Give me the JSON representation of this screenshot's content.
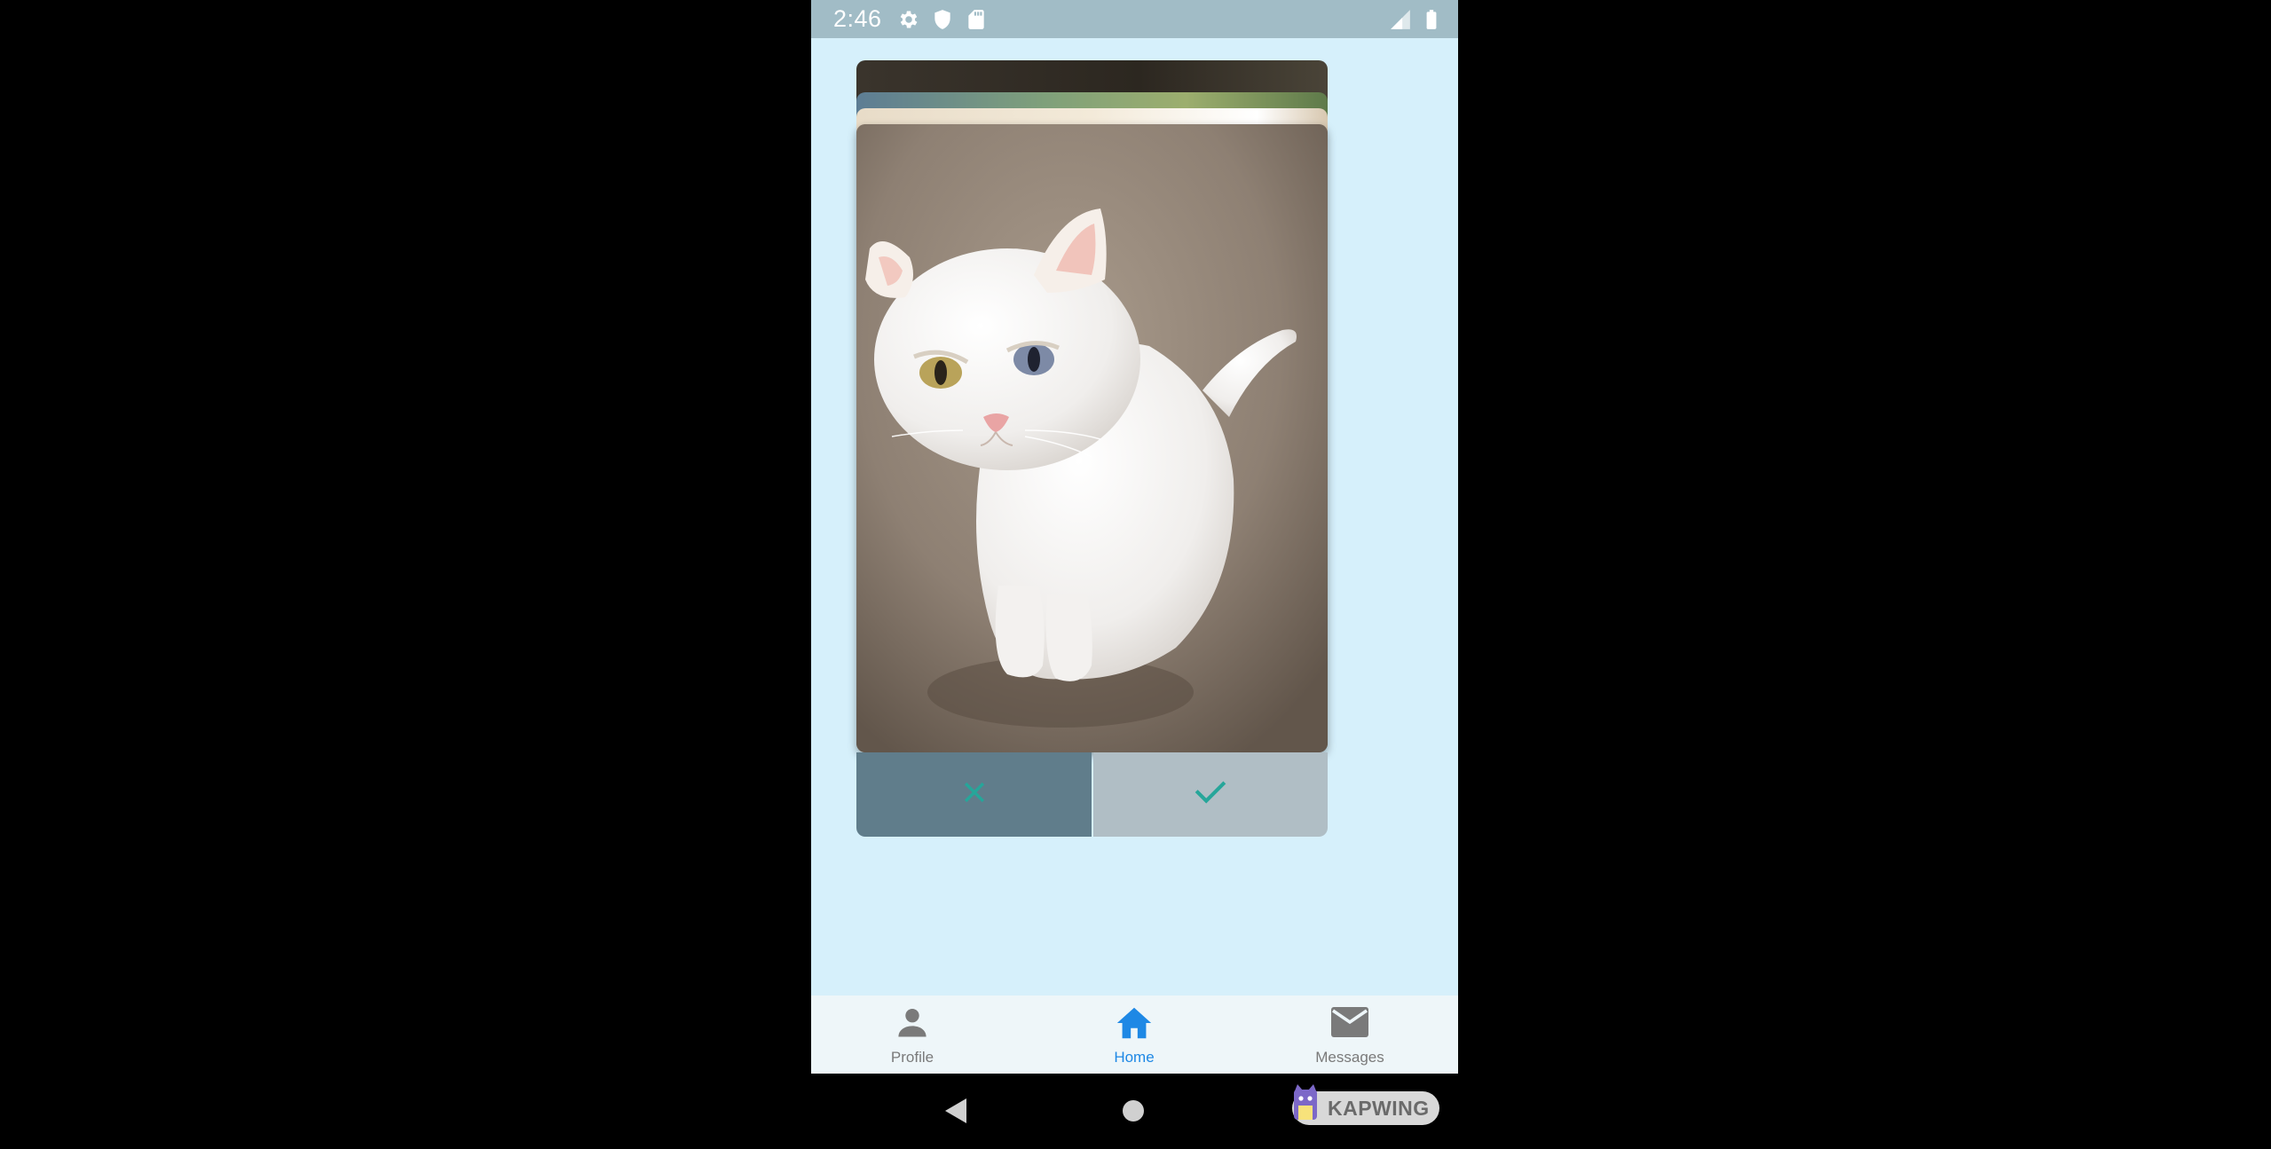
{
  "status_bar": {
    "time": "2:46",
    "icons": [
      "gear-icon",
      "shield-icon",
      "sd-card-icon",
      "signal-icon",
      "battery-icon"
    ]
  },
  "card_stack": {
    "current_card_subject": "white cat sitting on carpet"
  },
  "actions": {
    "reject_icon": "close-icon",
    "accept_icon": "check-icon"
  },
  "bottom_nav": {
    "items": [
      {
        "label": "Profile",
        "icon": "person-icon"
      },
      {
        "label": "Home",
        "icon": "home-icon"
      },
      {
        "label": "Messages",
        "icon": "mail-icon"
      }
    ],
    "active": "Home"
  },
  "system_nav": {
    "watermark": "KAPWING"
  },
  "colors": {
    "background": "#d6f0fb",
    "status_bar": "#a1bcc6",
    "reject_button": "#607d8b",
    "accept_button": "#b0bec5",
    "action_icon": "#26a69a",
    "active_nav": "#1e88e5",
    "inactive_nav": "#7a7a7a"
  }
}
